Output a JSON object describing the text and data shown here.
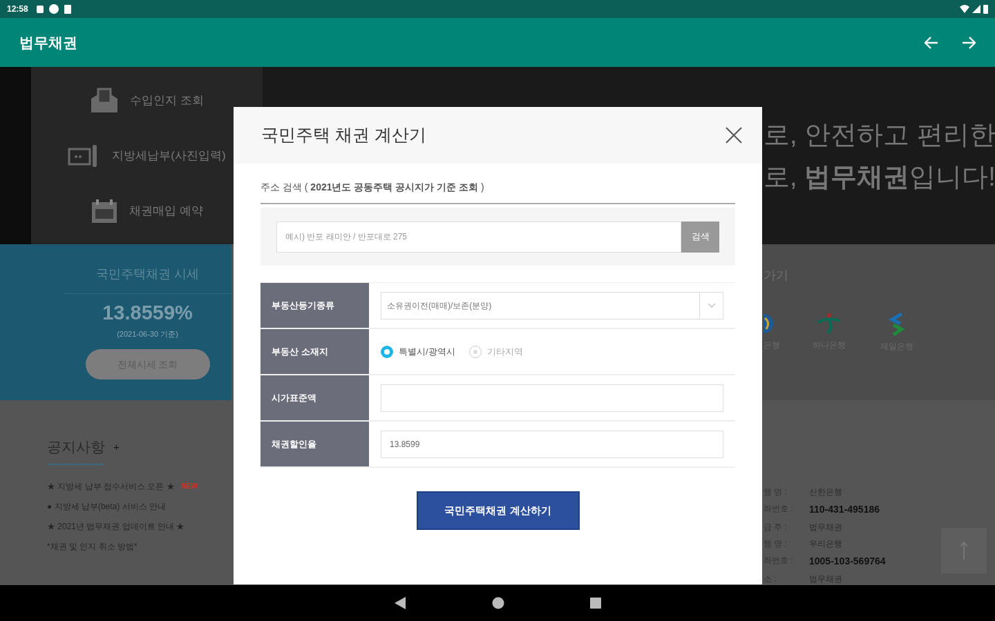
{
  "status_bar": {
    "time": "12:58"
  },
  "app_bar": {
    "title": "법무채권"
  },
  "hero": {
    "menu": [
      {
        "label": "수입인지 조회",
        "kind": "stamp"
      },
      {
        "label": "지방세납부(사진입력)",
        "kind": "card"
      },
      {
        "label": "채권매입 예약",
        "kind": "calendar"
      }
    ],
    "lines": [
      "로, 안전하고 편리한",
      "로, **법무채권**입니다!"
    ]
  },
  "price_panel": {
    "title": "국민주택채권 시세",
    "rate": "13.8559%",
    "date": "(2021-06-30 기준)",
    "button": "전체시세 조회"
  },
  "shortcuts": {
    "title": "가기",
    "banks": [
      {
        "label": "은행",
        "kind": "globe"
      },
      {
        "label": "하나은행",
        "kind": "hana"
      },
      {
        "label": "제일은행",
        "kind": "sc"
      }
    ]
  },
  "notices": {
    "title": "공지사항",
    "more": "+",
    "items": [
      {
        "text": "★ 지방세 납부 접수서비스 오픈 ★",
        "badge": "NEW"
      },
      {
        "text": "● 지방세 납부(beta) 서비스 안내"
      },
      {
        "text": "★ 2021년 법무채권 업데이트 안내 ★"
      },
      {
        "text": "*채권 및 인지 취소 방법*"
      }
    ]
  },
  "accounts": [
    {
      "label": "행 명 :",
      "value": "신한은행",
      "kind": "text"
    },
    {
      "label": "좌번호 :",
      "value": "110-431-495186",
      "kind": "number"
    },
    {
      "label": "금 주 :",
      "value": "법무채권",
      "kind": "text"
    },
    {
      "label": "행 명 :",
      "value": "우리은행",
      "kind": "text"
    },
    {
      "label": "좌번호 :",
      "value": "1005-103-569764",
      "kind": "number"
    },
    {
      "label": "소 :",
      "value": "법무채권",
      "kind": "text"
    }
  ],
  "dialog": {
    "title": "국민주택 채권 계산기",
    "search_label": "주소 검색 ( **2021년도 공동주택 공시지가 기준 조회** )",
    "search_placeholder": "예시) 반포 래미안 / 반포대로 275",
    "search_button": "검색",
    "rows": [
      {
        "label": "부동산등기종류",
        "kind": "select",
        "value": "소유권이전(매매)/보존(분양)"
      },
      {
        "label": "부동산 소재지",
        "kind": "radio",
        "options": [
          {
            "label": "특별시/광역시",
            "selected": true
          },
          {
            "label": "기타지역",
            "selected": false
          }
        ]
      },
      {
        "label": "시가표준액",
        "kind": "input",
        "value": ""
      },
      {
        "label": "채권할인율",
        "kind": "input",
        "value": "13.8599"
      }
    ],
    "submit": "국민주택채권 계산하기"
  }
}
